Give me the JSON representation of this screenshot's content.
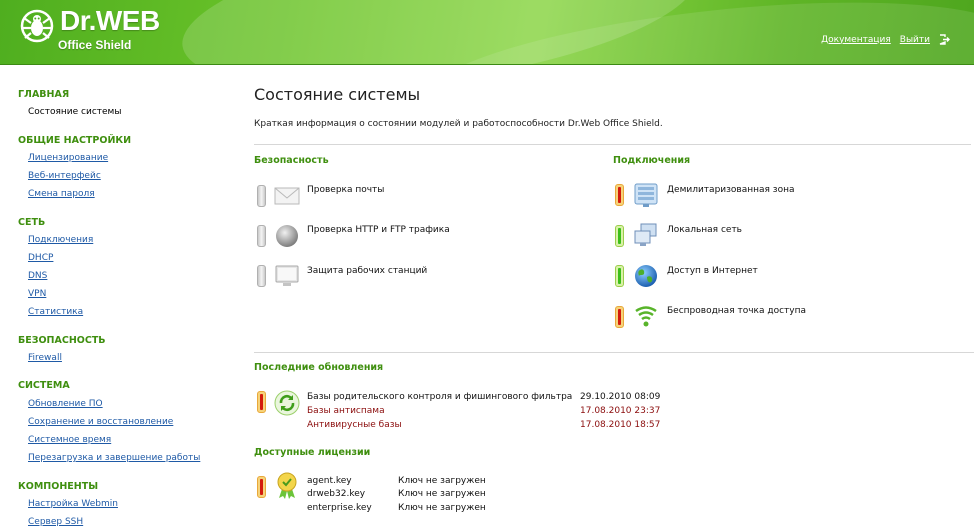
{
  "header": {
    "brand": "Dr.WEB",
    "product": "Office Shield",
    "docs_link": "Документация",
    "logout_link": "Выйти"
  },
  "sidebar": {
    "sections": [
      {
        "title": "ГЛАВНАЯ",
        "items": [
          {
            "label": "Состояние системы",
            "current": true
          }
        ]
      },
      {
        "title": "ОБЩИЕ НАСТРОЙКИ",
        "items": [
          {
            "label": "Лицензирование"
          },
          {
            "label": "Веб-интерфейс"
          },
          {
            "label": "Смена пароля"
          }
        ]
      },
      {
        "title": "СЕТЬ",
        "items": [
          {
            "label": "Подключения"
          },
          {
            "label": "DHCP"
          },
          {
            "label": "DNS"
          },
          {
            "label": "VPN"
          },
          {
            "label": "Статистика"
          }
        ]
      },
      {
        "title": "БЕЗОПАСНОСТЬ",
        "items": [
          {
            "label": "Firewall"
          }
        ]
      },
      {
        "title": "СИСТЕМА",
        "items": [
          {
            "label": "Обновление ПО"
          },
          {
            "label": "Сохранение и восстановление"
          },
          {
            "label": "Системное время"
          },
          {
            "label": "Перезагрузка и завершение работы"
          }
        ]
      },
      {
        "title": "КОМПОНЕНТЫ",
        "items": [
          {
            "label": "Настройка Webmin"
          },
          {
            "label": "Сервер SSH"
          }
        ]
      }
    ]
  },
  "main": {
    "title": "Состояние системы",
    "description": "Краткая информация о состоянии модулей и работоспособности Dr.Web Office Shield.",
    "security": {
      "title": "Безопасность",
      "items": [
        {
          "label": "Проверка почты",
          "status": "off",
          "icon": "mail-icon"
        },
        {
          "label": "Проверка HTTP и FTP трафика",
          "status": "off",
          "icon": "globe-gray-icon"
        },
        {
          "label": "Защита рабочих станций",
          "status": "off",
          "icon": "monitor-icon"
        }
      ]
    },
    "connections": {
      "title": "Подключения",
      "items": [
        {
          "label": "Демилитаризованная зона",
          "status": "error",
          "icon": "server-icon"
        },
        {
          "label": "Локальная сеть",
          "status": "ok",
          "icon": "lan-icon"
        },
        {
          "label": "Доступ в Интернет",
          "status": "ok",
          "icon": "internet-globe-icon"
        },
        {
          "label": "Беспроводная точка доступа",
          "status": "error",
          "icon": "wifi-icon"
        }
      ]
    },
    "updates": {
      "title": "Последние обновления",
      "status": "error",
      "rows": [
        {
          "name": "Базы родительского контроля и фишингового фильтра",
          "date": "29.10.2010 08:09",
          "stale": false
        },
        {
          "name": "Базы антиспама",
          "date": "17.08.2010 23:37",
          "stale": true
        },
        {
          "name": "Антивирусные базы",
          "date": "17.08.2010 18:57",
          "stale": true
        }
      ]
    },
    "licenses": {
      "title": "Доступные лицензии",
      "status": "error",
      "rows": [
        {
          "key": "agent.key",
          "state": "Ключ не загружен"
        },
        {
          "key": "drweb32.key",
          "state": "Ключ не загружен"
        },
        {
          "key": "enterprise.key",
          "state": "Ключ не загружен"
        }
      ]
    }
  }
}
